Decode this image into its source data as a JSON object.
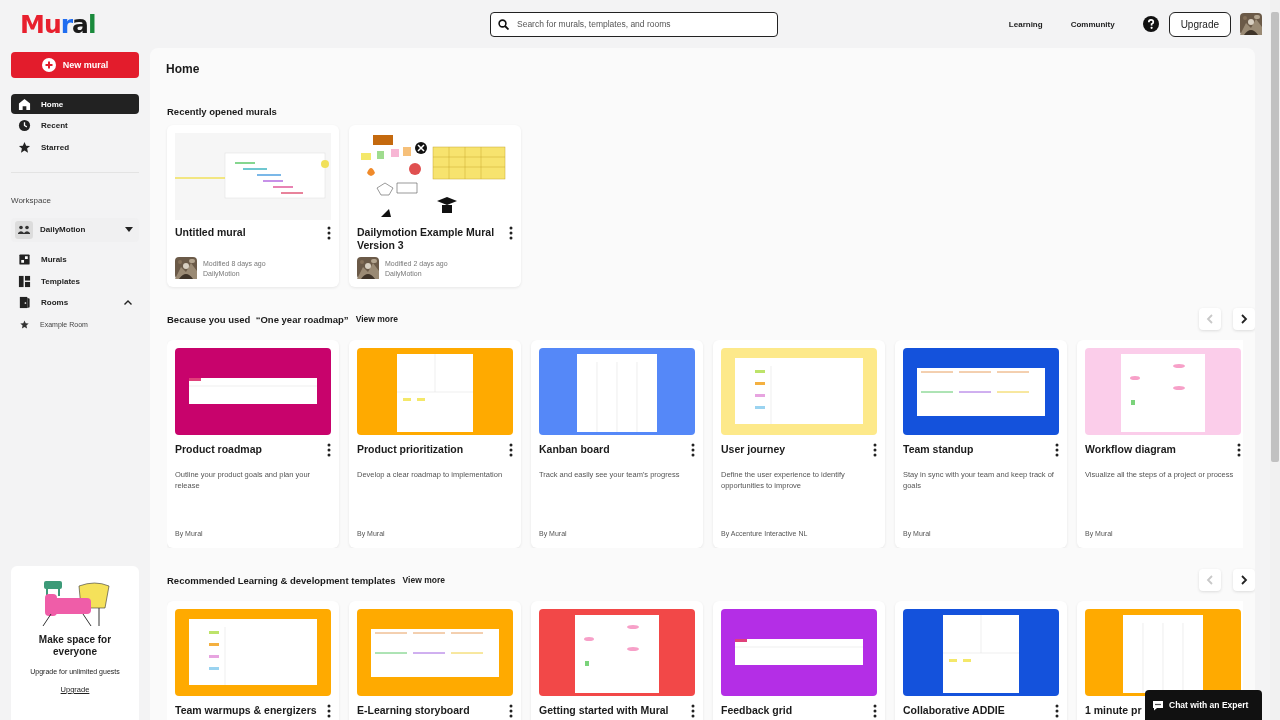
{
  "logo": "Mural",
  "search": {
    "placeholder": "Search for murals, templates, and rooms"
  },
  "top_links": [
    "Learning",
    "Community"
  ],
  "upgrade_button": "Upgrade",
  "sidebar": {
    "new_button": "New mural",
    "nav": [
      {
        "label": "Home",
        "selected": true
      },
      {
        "label": "Recent",
        "selected": false
      },
      {
        "label": "Starred",
        "selected": false
      }
    ],
    "workspace_label": "Workspace",
    "workspace": "DailyMotion",
    "sections": [
      {
        "label": "Murals"
      },
      {
        "label": "Templates"
      },
      {
        "label": "Rooms",
        "expanded": true,
        "children": [
          {
            "label": "Example Room"
          }
        ]
      }
    ],
    "promo": {
      "title": "Make space for everyone",
      "text": "Upgrade for unlimited guests",
      "link": "Upgrade"
    }
  },
  "page_title": "Home",
  "recent": {
    "title": "Recently opened murals",
    "murals": [
      {
        "title": "Untitled mural",
        "modified": "Modified 8 days ago",
        "owner": "DailyMotion",
        "kind": "timeline"
      },
      {
        "title": "Dailymotion Example Mural Version 3",
        "modified": "Modified 2 days ago",
        "owner": "DailyMotion",
        "kind": "board"
      }
    ]
  },
  "rows": [
    {
      "title": "Because you used  “One year roadmap”",
      "view_more": "View more",
      "nav": [
        {
          "kind": "prev",
          "disabled": true
        },
        {
          "kind": "next",
          "disabled": false
        }
      ],
      "templates": [
        {
          "title": "Product roadmap",
          "description": "Outline your product goals and plan your release",
          "author": "By Mural",
          "color": "#c8036c"
        },
        {
          "title": "Product prioritization",
          "description": "Develop a clear roadmap to implementation",
          "author": "By Mural",
          "color": "#ffaa00"
        },
        {
          "title": "Kanban board",
          "description": "Track and easily see your team's progress",
          "author": "By Mural",
          "color": "#5588f8"
        },
        {
          "title": "User journey",
          "description": "Define the user experience to identify opportunities to improve",
          "author": "By Accenture Interactive NL",
          "color": "#fde98a"
        },
        {
          "title": "Team standup",
          "description": "Stay in sync with your team and keep track of goals",
          "author": "By Mural",
          "color": "#1452dc"
        },
        {
          "title": "Workflow diagram",
          "description": "Visualize all the steps of a project or process",
          "author": "By Mural",
          "color": "#fbcdea"
        }
      ]
    },
    {
      "title": "Recommended Learning & development templates",
      "view_more": "View more",
      "nav": [
        {
          "kind": "prev",
          "disabled": true
        },
        {
          "kind": "next",
          "disabled": false
        }
      ],
      "templates": [
        {
          "title": "Team warmups & energizers",
          "color": "#ffaa00"
        },
        {
          "title": "E-Learning storyboard",
          "color": "#ffaa00"
        },
        {
          "title": "Getting started with Mural",
          "color": "#f24848"
        },
        {
          "title": "Feedback grid",
          "color": "#b42ee6"
        },
        {
          "title": "Collaborative ADDIE",
          "color": "#1452dc"
        },
        {
          "title": "1 minute pr",
          "color": "#ffaa00"
        }
      ]
    }
  ],
  "chat_button": "Chat with an Expert"
}
